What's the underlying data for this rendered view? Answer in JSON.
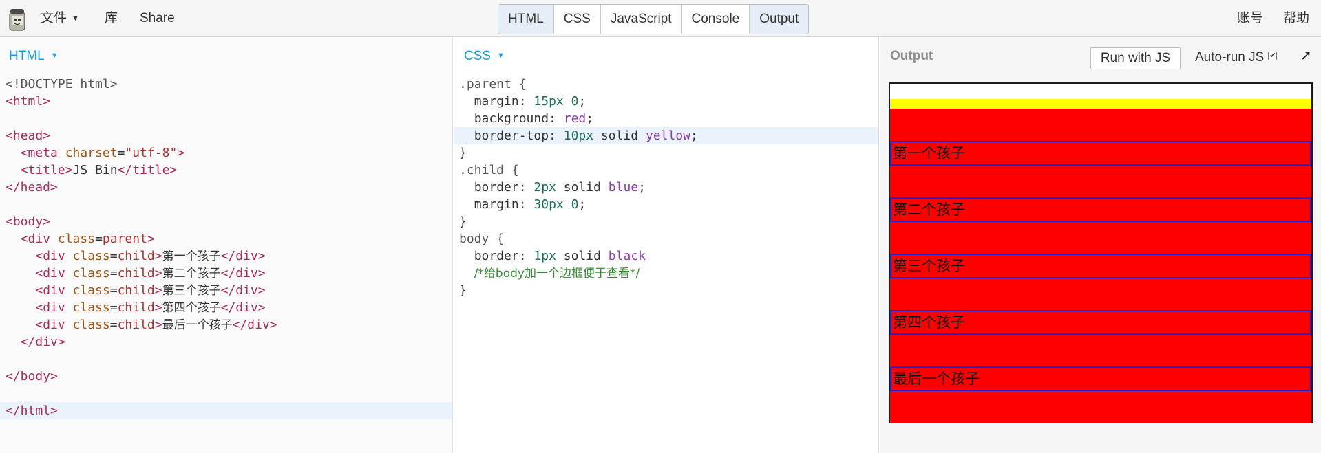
{
  "topbar": {
    "file_menu": "文件",
    "library_menu": "库",
    "share_menu": "Share",
    "tabs": [
      "HTML",
      "CSS",
      "JavaScript",
      "Console",
      "Output"
    ],
    "active_tabs": [
      "HTML",
      "Output"
    ],
    "account": "账号",
    "help": "帮助"
  },
  "html_panel": {
    "label": "HTML",
    "code": {
      "doctype": "<!DOCTYPE html>",
      "html_open": "<html>",
      "head_open": "<head>",
      "meta_open": "<meta ",
      "meta_attr": "charset",
      "meta_eq": "=",
      "meta_val": "\"utf-8\"",
      "meta_close": ">",
      "title_open": "<title>",
      "title_text": "JS Bin",
      "title_close": "</title>",
      "head_close": "</head>",
      "body_open": "<body>",
      "div_open": "<div ",
      "class_attr": "class",
      "eq": "=",
      "parent_val": "parent",
      "child_val": "child",
      "gt": ">",
      "div_close": "</div>",
      "children": [
        "第一个孩子",
        "第二个孩子",
        "第三个孩子",
        "第四个孩子",
        "最后一个孩子"
      ],
      "body_close": "</body>",
      "html_close": "</html>"
    }
  },
  "css_panel": {
    "label": "CSS",
    "code": {
      "parent_sel": ".parent {",
      "margin_prop": "margin: ",
      "margin_val": "15px 0",
      "bg_prop": "background: ",
      "bg_val": "red",
      "bt_prop": "border-top: ",
      "bt_num": "10px ",
      "bt_style": "solid ",
      "bt_color": "yellow",
      "semi": ";",
      "close": "}",
      "child_sel": ".child {",
      "border_prop": "border: ",
      "child_border_num": "2px ",
      "child_border_style": "solid ",
      "child_border_color": "blue",
      "child_margin_val": "30px 0",
      "body_sel": "body {",
      "body_border_num": "1px ",
      "body_border_style": "solid ",
      "body_border_color": "black",
      "comment": "/*给body加一个边框便于查看*/"
    }
  },
  "output_panel": {
    "title": "Output",
    "run_button": "Run with JS",
    "autorun_label": "Auto-run JS",
    "autorun_checked": true,
    "expand_icon": "arrow-up-right-icon",
    "rendered_children": [
      "第一个孩子",
      "第二个孩子",
      "第三个孩子",
      "第四个孩子",
      "最后一个孩子"
    ],
    "colors": {
      "parent_bg": "#ff0000",
      "parent_border_top": "#ffff00",
      "child_border": "#0000ff",
      "body_border": "#000000"
    }
  },
  "colors": {
    "accent": "#1a9cd8",
    "active_tab": "#e5edf6",
    "highlight_line": "#eaf2fc"
  }
}
